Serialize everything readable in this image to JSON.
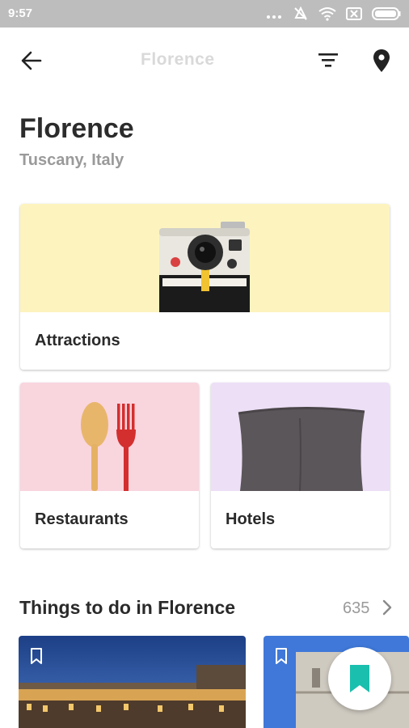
{
  "status_bar": {
    "time": "9:57"
  },
  "app_bar": {
    "title": "Florence"
  },
  "header": {
    "city": "Florence",
    "region": "Tuscany, Italy"
  },
  "categories": [
    {
      "label": "Attractions"
    },
    {
      "label": "Restaurants"
    },
    {
      "label": "Hotels"
    }
  ],
  "things_to_do": {
    "title": "Things to do in Florence",
    "count": "635"
  },
  "colors": {
    "attractions_bg": "#fdf3bf",
    "restaurants_bg": "#f9d5de",
    "hotels_bg": "#ecdff6",
    "bookmark_accent": "#1bbfae"
  },
  "icons": {
    "back": "arrow-left-icon",
    "filter": "filter-icon",
    "map": "map-pin-icon",
    "chevron": "chevron-right-icon",
    "bookmark": "bookmark-icon"
  }
}
